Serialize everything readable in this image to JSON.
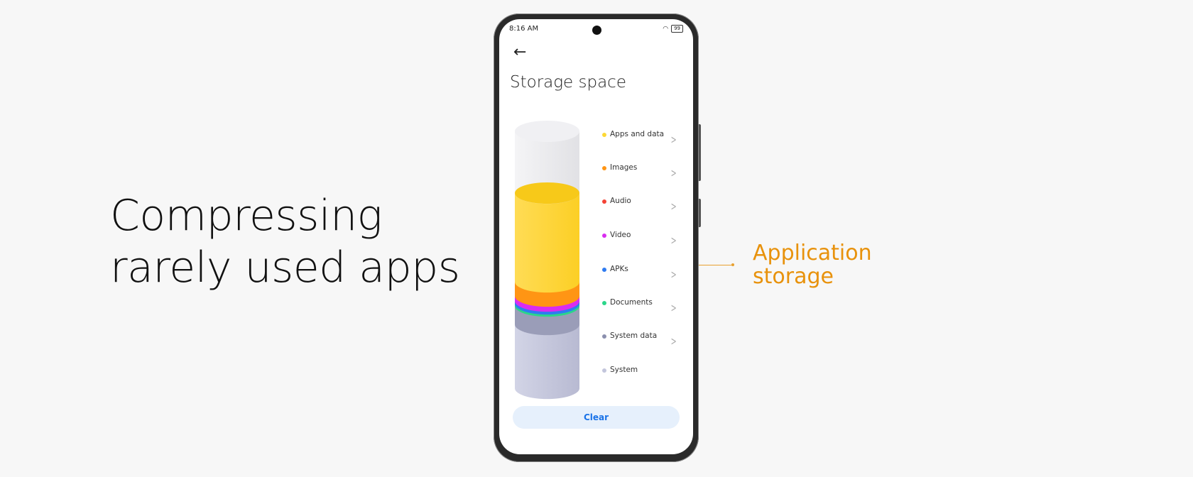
{
  "headline": {
    "line1": "Compressing",
    "line2": "rarely used apps"
  },
  "callout": {
    "line1": "Application",
    "line2": "storage",
    "color": "#e8920c"
  },
  "phone": {
    "status": {
      "time": "8:16 AM",
      "wifi_icon": "wifi-icon",
      "battery": "99"
    },
    "back_icon": "arrow-left-icon",
    "title": "Storage space",
    "legend": [
      {
        "label": "Apps and data",
        "color": "#fdd835",
        "chevron": true
      },
      {
        "label": "Images",
        "color": "#ff9514",
        "chevron": true
      },
      {
        "label": "Audio",
        "color": "#f44336",
        "chevron": true
      },
      {
        "label": "Video",
        "color": "#d92cf0",
        "chevron": true
      },
      {
        "label": "APKs",
        "color": "#2f7bf0",
        "chevron": true
      },
      {
        "label": "Documents",
        "color": "#2bd68a",
        "chevron": true
      },
      {
        "label": "System data",
        "color": "#8b8fae",
        "chevron": true
      },
      {
        "label": "System",
        "color": "#c3c6dc",
        "chevron": false
      }
    ],
    "clear_label": "Clear"
  }
}
